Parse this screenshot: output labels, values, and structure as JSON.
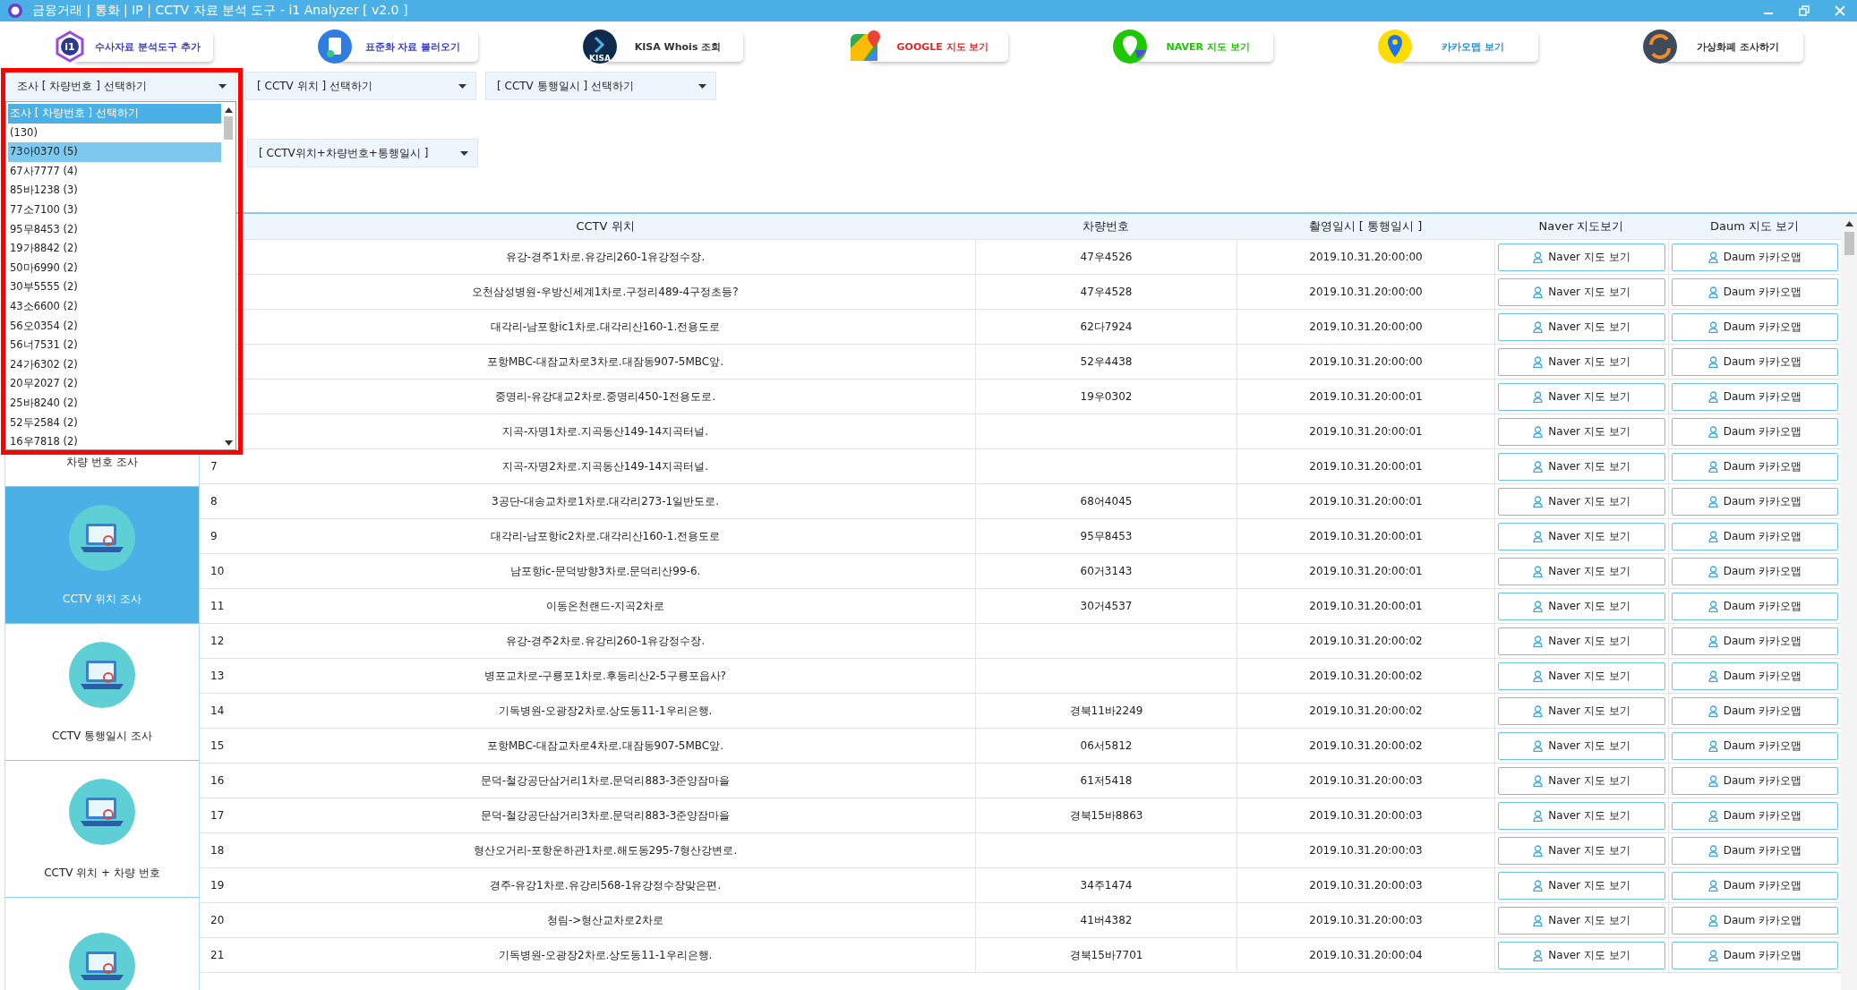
{
  "window": {
    "title": "금융거래 | 통화 | IP | CCTV 자료 분석 도구 - i1 Analyzer [ v2.0 ]"
  },
  "toolbar": [
    {
      "label": "수사자료 분석도구 추가",
      "kind": "logo",
      "icon_text": "i1",
      "color": "#3a3fc4"
    },
    {
      "label": "표준화 자료 불러오기",
      "kind": "document",
      "color": "#3a3fc4"
    },
    {
      "label": "KISA Whois 조회",
      "kind": "kisa",
      "icon_text": "KISA",
      "color": "#333333"
    },
    {
      "label": "GOOGLE 지도 보기",
      "kind": "google",
      "color": "#e02a2a"
    },
    {
      "label": "NAVER 지도 보기",
      "kind": "naver",
      "color": "#1ec800"
    },
    {
      "label": "카카오맵 보기",
      "kind": "kakao",
      "color": "#1e8fe0"
    },
    {
      "label": "가상화폐 조사하기",
      "kind": "crypto",
      "color": "#333333"
    }
  ],
  "filters": [
    {
      "label": "조사 [ 차량번호 ] 선택하기",
      "options": [
        {
          "label": "조사 [ 차량번호 ] 선택하기",
          "selected": true,
          "hovered": false
        },
        {
          "label": "(130)",
          "selected": false,
          "hovered": false
        },
        {
          "label": "73아0370 (5)",
          "selected": false,
          "hovered": true
        },
        {
          "label": "67사7777 (4)",
          "selected": false,
          "hovered": false
        },
        {
          "label": "85바1238 (3)",
          "selected": false,
          "hovered": false
        },
        {
          "label": "77소7100 (3)",
          "selected": false,
          "hovered": false
        },
        {
          "label": "95무8453 (2)",
          "selected": false,
          "hovered": false
        },
        {
          "label": "19가8842 (2)",
          "selected": false,
          "hovered": false
        },
        {
          "label": "50마6990 (2)",
          "selected": false,
          "hovered": false
        },
        {
          "label": "30부5555 (2)",
          "selected": false,
          "hovered": false
        },
        {
          "label": "43소6600 (2)",
          "selected": false,
          "hovered": false
        },
        {
          "label": "56오0354 (2)",
          "selected": false,
          "hovered": false
        },
        {
          "label": "56너7531 (2)",
          "selected": false,
          "hovered": false
        },
        {
          "label": "24가6302 (2)",
          "selected": false,
          "hovered": false
        },
        {
          "label": "20무2027 (2)",
          "selected": false,
          "hovered": false
        },
        {
          "label": "25바8240 (2)",
          "selected": false,
          "hovered": false
        },
        {
          "label": "52두2584 (2)",
          "selected": false,
          "hovered": false
        },
        {
          "label": "16우7818 (2)",
          "selected": false,
          "hovered": false
        }
      ]
    },
    {
      "label": "[ CCTV 위치 ] 선택하기"
    },
    {
      "label": "[ CCTV 통행일시 ] 선택하기"
    },
    {
      "label": "[ CCTV위치+차량번호+통행일시 ]"
    }
  ],
  "sidebar": {
    "items": [
      {
        "label": "차량 번호 조사",
        "selected": false
      },
      {
        "label": "CCTV 위치 조사",
        "selected": true,
        "icon": true
      },
      {
        "label": "CCTV 통행일시 조사",
        "selected": false,
        "icon": true
      },
      {
        "label": "CCTV 위치 + 차량 번호",
        "selected": false,
        "icon": true
      },
      {
        "selected": false,
        "icon": true
      }
    ]
  },
  "table": {
    "columns": [
      "CCTV 위치",
      "차량번호",
      "촬영일시 [ 통행일시 ]",
      "Naver 지도보기",
      "Daum 지도 보기"
    ],
    "rows": [
      {
        "location": "유강-경주1차로.유강리260-1유강정수장.",
        "plate": "47우4526",
        "time": "2019.10.31.20:00:00",
        "naver": "Naver 지도 보기",
        "daum": "Daum 카카오맵"
      },
      {
        "location": "오천삼성병원-우방신세계1차로.구정리489-4구정초등?",
        "plate": "47우4528",
        "time": "2019.10.31.20:00:00",
        "naver": "Naver 지도 보기",
        "daum": "Daum 카카오맵"
      },
      {
        "location": "대각리-남포항ic1차로.대각리산160-1.전용도로",
        "plate": "62다7924",
        "time": "2019.10.31.20:00:00",
        "naver": "Naver 지도 보기",
        "daum": "Daum 카카오맵"
      },
      {
        "location": "포항MBC-대잠교차로3차로.대잠동907-5MBC앞.",
        "plate": "52우4438",
        "time": "2019.10.31.20:00:00",
        "naver": "Naver 지도 보기",
        "daum": "Daum 카카오맵"
      },
      {
        "location": "중명리-유강대교2차로.중명리450-1전용도로.",
        "plate": "19우0302",
        "time": "2019.10.31.20:00:01",
        "naver": "Naver 지도 보기",
        "daum": "Daum 카카오맵"
      },
      {
        "location": "지곡-자명1차로.지곡동산149-14지곡터널.",
        "time": "2019.10.31.20:00:01",
        "naver": "Naver 지도 보기",
        "daum": "Daum 카카오맵"
      },
      {
        "no": "7",
        "location": "지곡-자명2차로.지곡동산149-14지곡터널.",
        "time": "2019.10.31.20:00:01",
        "naver": "Naver 지도 보기",
        "daum": "Daum 카카오맵"
      },
      {
        "no": "8",
        "location": "3공단-대송교차로1차로.대각리273-1일반도로.",
        "plate": "68어4045",
        "time": "2019.10.31.20:00:01",
        "naver": "Naver 지도 보기",
        "daum": "Daum 카카오맵"
      },
      {
        "no": "9",
        "location": "대각리-남포항ic2차로.대각리산160-1.전용도로",
        "plate": "95무8453",
        "time": "2019.10.31.20:00:01",
        "naver": "Naver 지도 보기",
        "daum": "Daum 카카오맵"
      },
      {
        "no": "10",
        "location": "남포항ic-문덕방향3차로.문덕리산99-6.",
        "plate": "60거3143",
        "time": "2019.10.31.20:00:01",
        "naver": "Naver 지도 보기",
        "daum": "Daum 카카오맵"
      },
      {
        "no": "11",
        "location": "이동온천랜드-지곡2차로",
        "plate": "30거4537",
        "time": "2019.10.31.20:00:01",
        "naver": "Naver 지도 보기",
        "daum": "Daum 카카오맵"
      },
      {
        "no": "12",
        "location": "유강-경주2차로.유강리260-1유강정수장.",
        "time": "2019.10.31.20:00:02",
        "naver": "Naver 지도 보기",
        "daum": "Daum 카카오맵"
      },
      {
        "no": "13",
        "location": "병포교차로-구룡포1차로.후동리산2-5구룡포읍사?",
        "time": "2019.10.31.20:00:02",
        "naver": "Naver 지도 보기",
        "daum": "Daum 카카오맵"
      },
      {
        "no": "14",
        "location": "기독병원-오광장2차로.상도동11-1우리은행.",
        "plate": "경북11바2249",
        "time": "2019.10.31.20:00:02",
        "naver": "Naver 지도 보기",
        "daum": "Daum 카카오맵"
      },
      {
        "no": "15",
        "location": "포항MBC-대잠교차로4차로.대잠동907-5MBC앞.",
        "plate": "06서5812",
        "time": "2019.10.31.20:00:02",
        "naver": "Naver 지도 보기",
        "daum": "Daum 카카오맵"
      },
      {
        "no": "16",
        "location": "문덕-철강공단삼거리1차로.문덕리883-3준양잠마을",
        "plate": "61저5418",
        "time": "2019.10.31.20:00:03",
        "naver": "Naver 지도 보기",
        "daum": "Daum 카카오맵"
      },
      {
        "no": "17",
        "location": "문덕-철강공단삼거리3차로.문덕리883-3준양잠마을",
        "plate": "경북15바8863",
        "time": "2019.10.31.20:00:03",
        "naver": "Naver 지도 보기",
        "daum": "Daum 카카오맵"
      },
      {
        "no": "18",
        "location": "형산오거리-포항운하관1차로.해도동295-7형산강변로.",
        "time": "2019.10.31.20:00:03",
        "naver": "Naver 지도 보기",
        "daum": "Daum 카카오맵"
      },
      {
        "no": "19",
        "location": "경주-유강1차로.유강리568-1유강정수장맞은편.",
        "plate": "34주1474",
        "time": "2019.10.31.20:00:03",
        "naver": "Naver 지도 보기",
        "daum": "Daum 카카오맵"
      },
      {
        "no": "20",
        "location": "청림->형산교차로2차로",
        "plate": "41버4382",
        "time": "2019.10.31.20:00:03",
        "naver": "Naver 지도 보기",
        "daum": "Daum 카카오맵"
      },
      {
        "no": "21",
        "location": "기독병원-오광장2차로.상도동11-1우리은행.",
        "plate": "경북15바7701",
        "time": "2019.10.31.20:00:04",
        "naver": "Naver 지도 보기",
        "daum": "Daum 카카오맵"
      }
    ]
  }
}
